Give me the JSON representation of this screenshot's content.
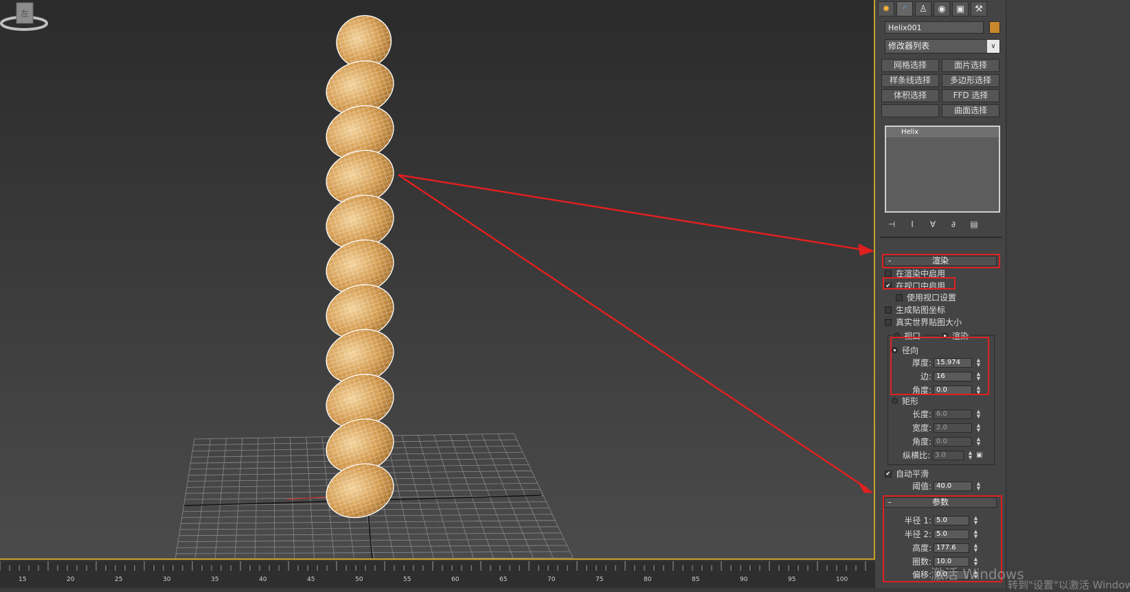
{
  "command_tabs": [
    {
      "icon": "create-icon",
      "glyph": "✹"
    },
    {
      "icon": "modify-icon",
      "glyph": "◜"
    },
    {
      "icon": "hierarchy-icon",
      "glyph": "♙"
    },
    {
      "icon": "motion-icon",
      "glyph": "◉"
    },
    {
      "icon": "display-icon",
      "glyph": "▣"
    },
    {
      "icon": "utilities-icon",
      "glyph": "⚒"
    }
  ],
  "object_name": "Helix001",
  "object_color": "#c8882c",
  "modifier_list": {
    "label": "修改器列表",
    "arrow": "∨"
  },
  "modifier_buttons": [
    "网格选择",
    "面片选择",
    "样条线选择",
    "多边形选择",
    "体积选择",
    "FFD 选择",
    "",
    "曲面选择"
  ],
  "stack": {
    "items": [
      "Helix"
    ]
  },
  "stack_tools": [
    "⊣",
    "Ⅰ",
    "∀",
    "∂",
    "▤"
  ],
  "render_rollout": {
    "minus": "-",
    "title": "渲染",
    "enable_in_renderer": "在渲染中启用",
    "enable_in_viewport": "在视口中启用",
    "enable_in_viewport_check": "✔",
    "use_viewport_settings": "使用视口设置",
    "gen_mapping": "生成贴图坐标",
    "real_world_map": "真实世界贴图大小",
    "viewport_radio": "视口",
    "render_radio": "渲染",
    "radial": "径向",
    "thickness_label": "厚度:",
    "thickness": "15.974",
    "sides_label": "边:",
    "sides": "16",
    "angle_label": "角度:",
    "angle": "0.0",
    "rectangular": "矩形",
    "length_label": "长度:",
    "length": "6.0",
    "width_label": "宽度:",
    "width": "2.0",
    "angle2_label": "角度:",
    "angle2": "0.0",
    "aspect_label": "纵横比:",
    "aspect": "3.0",
    "auto_smooth": "自动平滑",
    "auto_smooth_check": "✔",
    "threshold_label": "阈值:",
    "threshold": "40.0"
  },
  "params_rollout": {
    "minus": "-",
    "title": "参数",
    "radius1_label": "半径 1:",
    "radius1": "5.0",
    "radius2_label": "半径 2:",
    "radius2": "5.0",
    "height_label": "高度:",
    "height": "177.6",
    "turns_label": "圈数:",
    "turns": "10.0",
    "bias_label": "偏移:",
    "bias": "0.0"
  },
  "viewcube_label": "左",
  "timeline_labels": [
    "15",
    "20",
    "25",
    "30",
    "35",
    "40",
    "45",
    "50",
    "55",
    "60",
    "65",
    "70",
    "75",
    "80",
    "85",
    "90",
    "95",
    "100"
  ],
  "watermark": {
    "line1": "激活 Windows",
    "line2": "转到\"设置\"以激活 Windows"
  },
  "colors": {
    "highlight": "#e02020",
    "viewport_border": "#c9a227",
    "helix": "#c8882c"
  }
}
